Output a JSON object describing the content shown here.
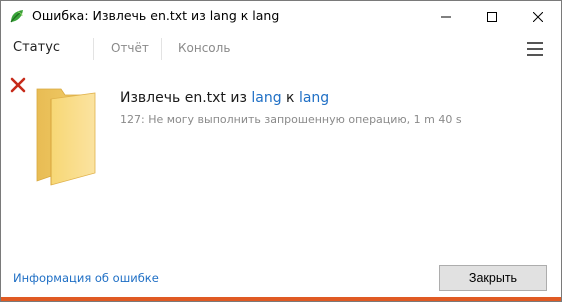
{
  "window": {
    "title": "Ошибка: Извлечь en.txt из lang к lang"
  },
  "tabs": [
    {
      "label": "Статус",
      "active": true
    },
    {
      "label": "Отчёт",
      "active": false
    },
    {
      "label": "Консоль",
      "active": false
    }
  ],
  "operation": {
    "prefix": "Извлечь en.txt из ",
    "source": "lang",
    "middle": " к ",
    "destination": "lang",
    "detail": "127: Не могу выполнить запрошенную операцию, 1 m 40 s"
  },
  "footer": {
    "error_info_link": "Информация об ошибке",
    "close_label": "Закрыть"
  },
  "colors": {
    "link": "#1f6fc5",
    "error_bar": "#e05a23",
    "error_x": "#c62a1a"
  },
  "icons": {
    "app": "green-leaf-icon",
    "error": "red-x-icon",
    "folder": "folder-icon",
    "menu": "hamburger-menu-icon"
  }
}
